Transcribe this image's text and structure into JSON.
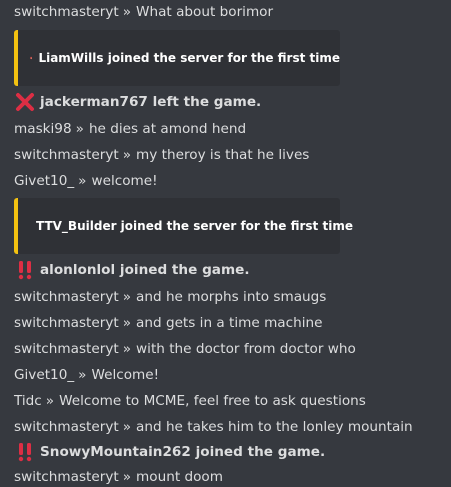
{
  "separator": "»",
  "colors": {
    "background": "#36393f",
    "embed_bg": "#2f3136",
    "embed_border": "#f4c211",
    "leave_icon": "#dd2e44",
    "join_icon": "#dd2e44"
  },
  "messages": [
    {
      "author": "switchmasteryt",
      "text": "What about borimor"
    },
    {
      "author": "maski98",
      "text": "he dies at amond hend"
    },
    {
      "author": "switchmasteryt",
      "text": "my theroy is that he lives"
    },
    {
      "author": "Givet10_",
      "text": "welcome!"
    },
    {
      "author": "switchmasteryt",
      "text": "and he morphs into smaugs"
    },
    {
      "author": "switchmasteryt",
      "text": "and gets in a time machine"
    },
    {
      "author": "switchmasteryt",
      "text": "with the doctor from doctor who"
    },
    {
      "author": "Givet10_",
      "text": "Welcome!"
    },
    {
      "author": "Tidc",
      "text": "Welcome to MCME, feel free to ask questions"
    },
    {
      "author": "switchmasteryt",
      "text": "and he takes him to the lonley mountain"
    },
    {
      "author": "switchmasteryt",
      "text": "mount doom"
    }
  ],
  "embeds": [
    {
      "text": "LiamWills joined the server for the first time",
      "avatar": "red-hair-avatar-icon"
    },
    {
      "text": "TTV_Builder joined the server for the first time",
      "avatar": "steve-avatar-icon"
    }
  ],
  "events": [
    {
      "text": "jackerman767 left the game.",
      "icon": "cross-mark-icon"
    },
    {
      "text": "alonlonlol joined the game.",
      "icon": "double-exclamation-icon"
    },
    {
      "text": "SnowyMountain262 joined the game.",
      "icon": "double-exclamation-icon"
    }
  ]
}
